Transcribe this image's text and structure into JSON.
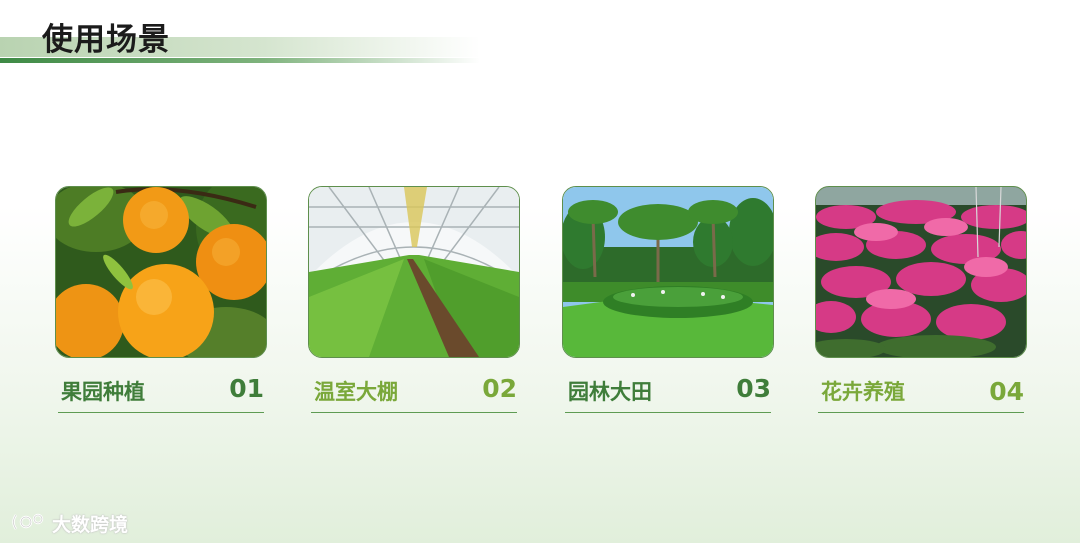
{
  "page": {
    "title": "使用场景"
  },
  "cards": [
    {
      "label": "果园种植",
      "number": "01",
      "image": "orange-orchard-photo",
      "label_color": "#3f7d3a",
      "number_color": "#3f7d3a"
    },
    {
      "label": "温室大棚",
      "number": "02",
      "image": "greenhouse-photo",
      "label_color": "#7aa83a",
      "number_color": "#7aa83a"
    },
    {
      "label": "园林大田",
      "number": "03",
      "image": "garden-park-photo",
      "label_color": "#3f7d3a",
      "number_color": "#3f7d3a"
    },
    {
      "label": "花卉养殖",
      "number": "04",
      "image": "flower-field-photo",
      "label_color": "#7aa83a",
      "number_color": "#7aa83a"
    }
  ],
  "watermark": {
    "text": "大数跨境",
    "icon": "dashuju-logo-icon"
  },
  "colors": {
    "accent_dark": "#3f7d3a",
    "accent_light": "#7aa83a"
  }
}
